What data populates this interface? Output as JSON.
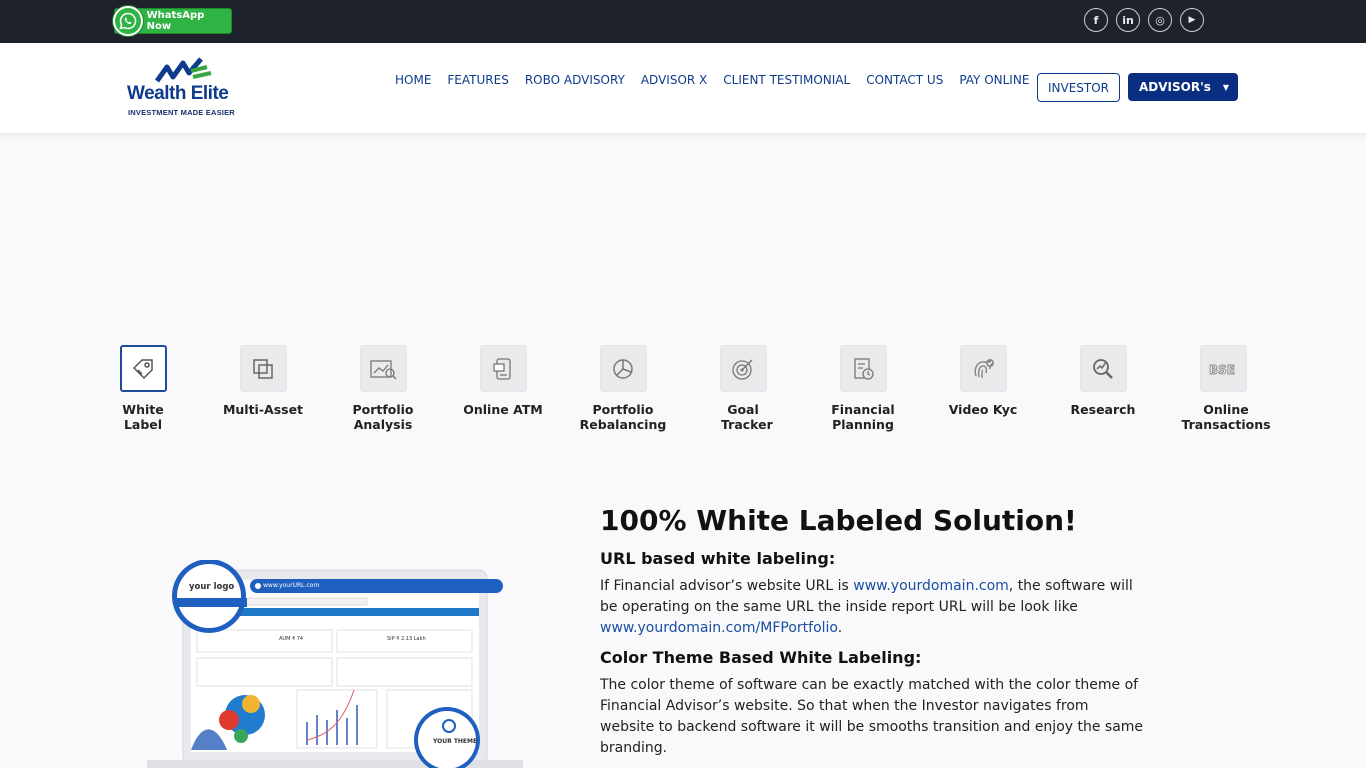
{
  "topbar": {
    "whatsapp_label": "WhatsApp Now",
    "socials": [
      {
        "icon": "facebook-icon",
        "glyph": "f"
      },
      {
        "icon": "linkedin-icon",
        "glyph": "in"
      },
      {
        "icon": "instagram-icon",
        "glyph": "◎"
      },
      {
        "icon": "youtube-icon",
        "glyph": "▶"
      }
    ]
  },
  "header": {
    "logo_name": "Wealth Elite",
    "logo_tagline": "INVESTMENT MADE EASIER",
    "nav": [
      "HOME",
      "FEATURES",
      "ROBO ADVISORY",
      "ADVISOR X",
      "CLIENT TESTIMONIAL",
      "CONTACT US",
      "PAY ONLINE"
    ],
    "investor_label": "INVESTOR",
    "advisor_label": "ADVISOR's",
    "advisor_caret": "▼"
  },
  "features": [
    {
      "label": "White Label",
      "icon": "white-label-icon"
    },
    {
      "label": "Multi-Asset",
      "icon": "multi-asset-icon"
    },
    {
      "label": "Portfolio Analysis",
      "icon": "portfolio-analysis-icon"
    },
    {
      "label": "Online ATM",
      "icon": "online-atm-icon"
    },
    {
      "label": "Portfolio Rebalancing",
      "icon": "portfolio-rebalancing-icon"
    },
    {
      "label": "Goal Tracker",
      "icon": "goal-tracker-icon"
    },
    {
      "label": "Financial Planning",
      "icon": "financial-planning-icon"
    },
    {
      "label": "Video Kyc",
      "icon": "video-kyc-icon"
    },
    {
      "label": "Research",
      "icon": "research-icon"
    },
    {
      "label": "Online Transactions",
      "icon": "bse-icon"
    }
  ],
  "content": {
    "title": "100% White Labeled Solution!",
    "sub1": "URL based white labeling:",
    "p1_a": "If Financial advisor’s website URL is ",
    "p1_link1": "www.yourdomain.com",
    "p1_b": ", the software will be operating on the same URL the inside report URL will be look like ",
    "p1_link2": "www.yourdomain.com/MFPortfolio",
    "p1_c": ".",
    "sub2": "Color Theme Based White Labeling:",
    "p2": "The color theme of software can be exactly matched with the color theme of Financial Advisor’s website. So that when the Investor navigates from website to backend software it will be smooths transition and enjoy the same branding."
  },
  "illustration": {
    "logo_text": "your logo",
    "url_text": "www.yourURL.com",
    "theme_text": "YOUR THEME",
    "aum": "AUM ₹ 74",
    "sip": "SIP ₹ 2.13 Lakh"
  },
  "colors": {
    "brand_blue": "#0a2f82",
    "topbar": "#1e222b",
    "whatsapp_green": "#2fb344"
  }
}
